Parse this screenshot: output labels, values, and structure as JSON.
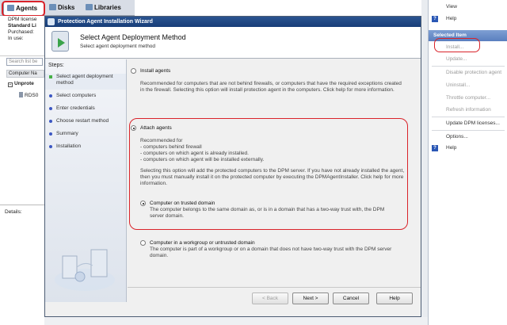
{
  "console": {
    "tabs": [
      {
        "label": "Agents"
      },
      {
        "label": "Disks"
      },
      {
        "label": "Libraries"
      }
    ],
    "info": {
      "dpm_licenses": "DPM license",
      "standard": "Standard Li",
      "purchased": "Purchased:",
      "in_use": "In use:"
    },
    "search_placeholder": "Search list be",
    "column_header": "Computer Na",
    "group": "Unprote",
    "server": "RDS0",
    "details_label": "Details:"
  },
  "actions": {
    "top_items": [
      "View",
      "Help"
    ],
    "section_header": "Selected Item",
    "items": [
      {
        "label": "Install...",
        "enabled": false
      },
      {
        "label": "Update...",
        "enabled": false
      },
      {
        "label": "Disable protection agent",
        "enabled": false
      },
      {
        "label": "Uninstall...",
        "enabled": false
      },
      {
        "label": "Throttle computer...",
        "enabled": false
      },
      {
        "label": "Refresh information",
        "enabled": false
      },
      {
        "label": "Update DPM licenses...",
        "enabled": true
      },
      {
        "label": "Options...",
        "enabled": true
      },
      {
        "label": "Help",
        "enabled": true
      }
    ]
  },
  "wizard": {
    "title": "Protection Agent Installation Wizard",
    "heading": "Select Agent Deployment Method",
    "subheading": "Select agent deployment method",
    "steps_label": "Steps:",
    "steps": [
      "Select agent deployment method",
      "Select computers",
      "Enter credentials",
      "Choose restart method",
      "Summary",
      "Installation"
    ],
    "current_step": 0,
    "options": {
      "install": {
        "label": "Install agents",
        "desc": "Recommended for computers that are not behind firewalls, or computers that have the required exceptions created in the firewall. Selecting this option will install protection agent in the computers. Click help for more information.",
        "selected": false
      },
      "attach": {
        "label": "Attach agents",
        "recommended_for": "Recommended for",
        "bullets": [
          "- computers behind firewall",
          "- computers on which agent is already installed.",
          "- computers on which agent will be installed externally."
        ],
        "desc": "Selecting this option will add the protected computers to the DPM server. If you have not already installed the agent, then you must manually install it on the protected computer by executing the DPMAgentInstaller. Click help for more information.",
        "selected": true
      },
      "trusted": {
        "label": "Computer on trusted domain",
        "desc": "The computer belongs to the same domain as, or is in a domain that has a two-way trust with, the DPM server domain.",
        "selected": true
      },
      "workgroup": {
        "label": "Computer in a workgroup or untrusted domain",
        "desc": "The computer is part of a workgroup or on a domain that does not have two-way trust with the DPM server domain.",
        "selected": false
      }
    },
    "buttons": {
      "back": "< Back",
      "next": "Next >",
      "cancel": "Cancel",
      "help": "Help"
    }
  },
  "colors": {
    "highlight": "#d9232a",
    "title_bar": "#1f4a88",
    "action_header": "#5a7fbf"
  }
}
